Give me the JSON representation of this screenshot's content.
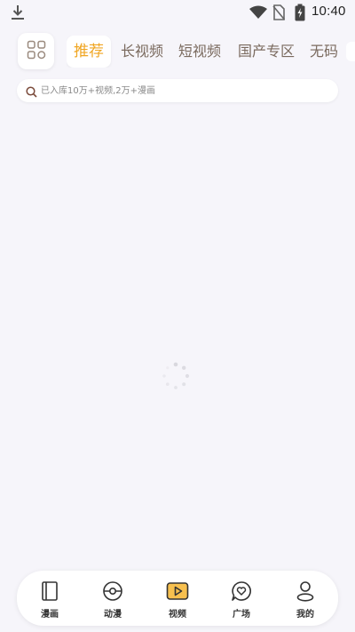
{
  "status_bar": {
    "time": "10:40",
    "icons": [
      "download-icon",
      "wifi-icon",
      "no-sim-icon",
      "battery-charging-icon"
    ]
  },
  "header": {
    "menu_icon": "grid-apps-icon",
    "tabs": [
      {
        "label": "推荐",
        "active": true
      },
      {
        "label": "长视频",
        "active": false
      },
      {
        "label": "短视频",
        "active": false
      },
      {
        "label": "国产专区",
        "active": false
      },
      {
        "label": "无码",
        "active": false
      }
    ]
  },
  "search": {
    "placeholder": "已入库10万+视频,2万+漫画",
    "icon": "search-icon"
  },
  "content": {
    "loading_icon": "loading-spinner-icon"
  },
  "bottom_nav": {
    "items": [
      {
        "label": "漫画",
        "icon": "book-icon",
        "active": false
      },
      {
        "label": "动漫",
        "icon": "disc-icon",
        "active": false
      },
      {
        "label": "视频",
        "icon": "play-icon",
        "active": true
      },
      {
        "label": "广场",
        "icon": "chat-heart-icon",
        "active": false
      },
      {
        "label": "我的",
        "icon": "user-icon",
        "active": false
      }
    ]
  },
  "colors": {
    "accent": "#f0a623",
    "active_icon_fill": "#f7c04f",
    "tab_text": "#7a6a5e",
    "background": "#f6f5fa"
  }
}
